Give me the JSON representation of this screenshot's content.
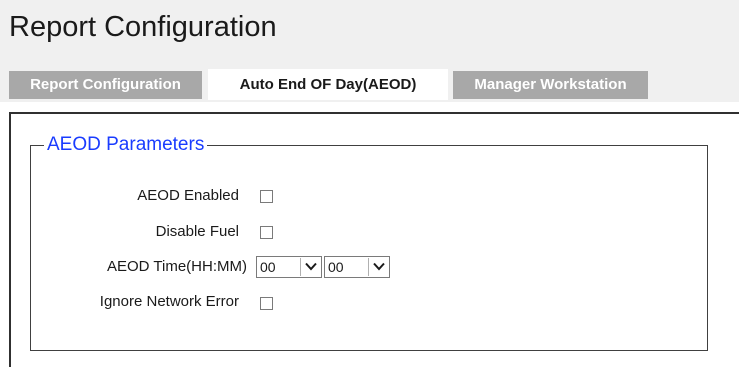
{
  "page": {
    "title": "Report Configuration"
  },
  "tabs": [
    {
      "label": "Report Configuration",
      "active": false
    },
    {
      "label": "Auto End OF Day(AEOD)",
      "active": true
    },
    {
      "label": "Manager Workstation",
      "active": false
    }
  ],
  "aeod": {
    "legend": "AEOD Parameters",
    "fields": {
      "aeod_enabled": {
        "label": "AEOD Enabled",
        "checked": false
      },
      "disable_fuel": {
        "label": "Disable Fuel",
        "checked": false
      },
      "aeod_time": {
        "label": "AEOD Time(HH:MM)",
        "hours": "00",
        "minutes": "00"
      },
      "ignore_network_error": {
        "label": "Ignore Network Error",
        "checked": false
      }
    }
  },
  "colors": {
    "legend": "#1a3cff",
    "tab_inactive_bg": "#a8a8a8",
    "tab_active_bg": "#ffffff",
    "header_bg": "#f0f0f0"
  }
}
